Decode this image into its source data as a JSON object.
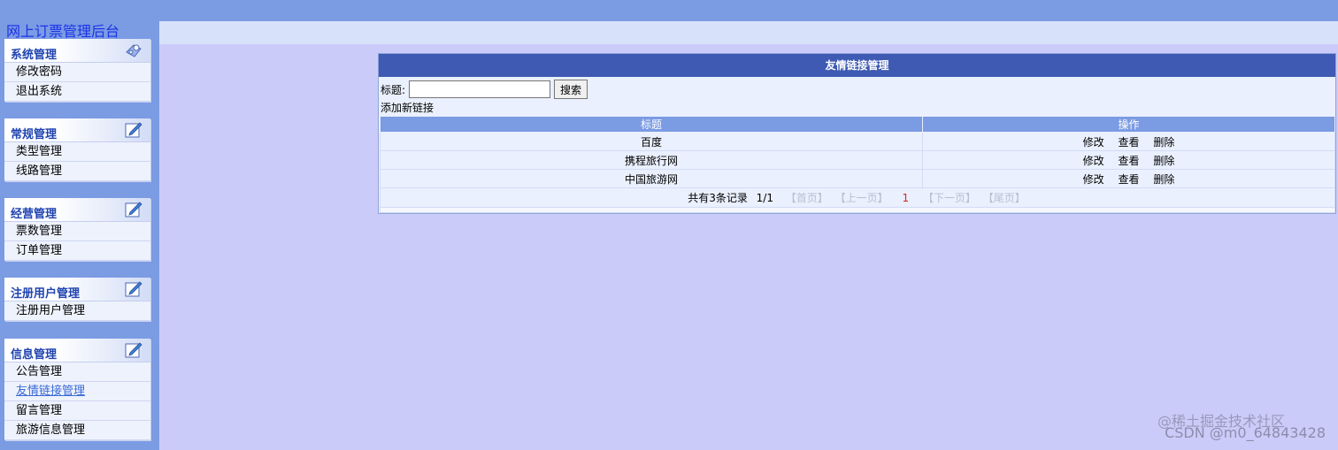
{
  "app_title": "网上订票管理后台",
  "colors": {
    "sidebar": "#7b9be3",
    "content_bg": "#cbcbf9",
    "panel_header": "#3e5ab3",
    "menu_label": "#1f43b0",
    "active_link": "#3a6ad7",
    "current_page": "#e02020"
  },
  "sidebar": {
    "menus": [
      {
        "title": "系统管理",
        "icon": "settings-icon",
        "items": [
          "修改密码",
          "退出系统"
        ]
      },
      {
        "title": "常规管理",
        "icon": "edit-icon",
        "items": [
          "类型管理",
          "线路管理"
        ]
      },
      {
        "title": "经营管理",
        "icon": "edit-icon",
        "items": [
          "票数管理",
          "订单管理"
        ]
      },
      {
        "title": "注册用户管理",
        "icon": "edit-icon",
        "items": [
          "注册用户管理"
        ]
      },
      {
        "title": "信息管理",
        "icon": "edit-icon",
        "items": [
          "公告管理",
          "友情链接管理",
          "留言管理",
          "旅游信息管理"
        ],
        "active_item": "友情链接管理"
      }
    ]
  },
  "panel": {
    "title": "友情链接管理",
    "search": {
      "label": "标题:",
      "value": "",
      "placeholder": "",
      "button": "搜索"
    },
    "add_link": "添加新链接",
    "columns": [
      "标题",
      "操作"
    ],
    "rows": [
      {
        "title": "百度",
        "actions": [
          "修改",
          "查看",
          "删除"
        ]
      },
      {
        "title": "携程旅行网",
        "actions": [
          "修改",
          "查看",
          "删除"
        ]
      },
      {
        "title": "中国旅游网",
        "actions": [
          "修改",
          "查看",
          "删除"
        ]
      }
    ],
    "pager": {
      "total": "共有3条记录",
      "page": "1/1",
      "first": "【首页】",
      "prev": "【上一页】",
      "current": "1",
      "next": "【下一页】",
      "last": "【尾页】"
    }
  },
  "watermark": "CSDN @m0_64843428",
  "watermark2": "@稀土掘金技术社区"
}
